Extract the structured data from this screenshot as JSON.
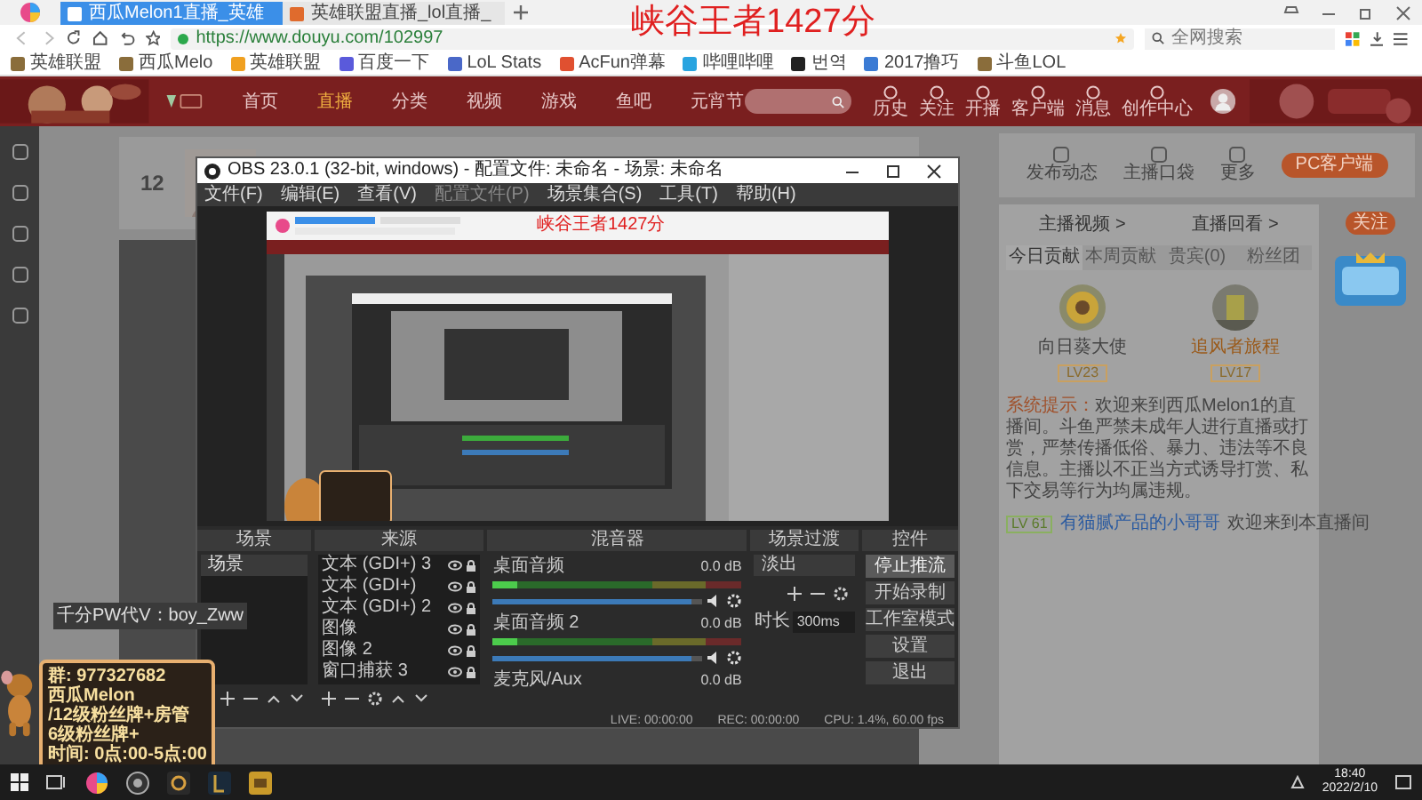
{
  "browser": {
    "tabs": [
      {
        "label": "西瓜Melon1直播_英雄",
        "selected": true
      },
      {
        "label": "英雄联盟直播_lol直播_",
        "selected": false
      }
    ],
    "address": "https://www.douyu.com/102997",
    "search_placeholder": "全网搜索",
    "bookmarks": [
      "英雄联盟",
      "西瓜Melo",
      "英雄联盟",
      "百度一下",
      "LoL Stats",
      "AcFun弹幕",
      "哔哩哔哩",
      "번역",
      "2017撸巧",
      "斗鱼LOL"
    ]
  },
  "overlay_title": "峡谷王者1427分",
  "site": {
    "nav": [
      {
        "label": "首页",
        "selected": false
      },
      {
        "label": "直播",
        "selected": true
      },
      {
        "label": "分类",
        "selected": false
      },
      {
        "label": "视频",
        "selected": false
      },
      {
        "label": "游戏",
        "selected": false
      },
      {
        "label": "鱼吧",
        "selected": false
      },
      {
        "label": "元宵节",
        "selected": false
      }
    ],
    "actions": [
      "历史",
      "关注",
      "开播",
      "客户端",
      "消息",
      "创作中心"
    ],
    "count": "12"
  },
  "chat_panel": {
    "tools": [
      "发布动态",
      "主播口袋",
      "更多"
    ],
    "client_button": "PC客户端",
    "links": [
      "主播视频 >",
      "直播回看 >"
    ],
    "follow_button": "关注",
    "tabs": [
      {
        "label": "今日贡献",
        "selected": true
      },
      {
        "label": "本周贡献",
        "selected": false
      },
      {
        "label": "贵宾(0)",
        "selected": false
      },
      {
        "label": "粉丝团",
        "selected": false
      }
    ],
    "fans": [
      {
        "name": "向日葵大使",
        "badge": "LV23"
      },
      {
        "name": "追风者旅程",
        "badge": "LV17"
      }
    ],
    "system_label": "系统提示：",
    "system_text": "欢迎来到西瓜Melon1的直播间。斗鱼严禁未成年人进行直播或打赏，严禁传播低俗、暴力、违法等不良信息。主播以不正当方式诱导打赏、私下交易等行为均属违规。",
    "chat_line": {
      "badge": "LV 61",
      "user": "有猫腻产品的小哥哥",
      "text": "欢迎来到本直播间"
    }
  },
  "streamer_note": "千分PW代V：boy_Zww",
  "info_card": [
    "群: 977327682",
    "西瓜Melon",
    "/12级粉丝牌+房管",
    "6级粉丝牌+",
    "时间: 0点:00-5点:00"
  ],
  "obs": {
    "title": "OBS 23.0.1 (32-bit, windows) - 配置文件: 未命名 - 场景: 未命名",
    "menu": [
      "文件(F)",
      "编辑(E)",
      "查看(V)",
      "配置文件(P)",
      "场景集合(S)",
      "工具(T)",
      "帮助(H)"
    ],
    "capture_title": "峡谷王者1427分",
    "docks": [
      "场景",
      "来源",
      "混音器",
      "场景过渡",
      "控件"
    ],
    "scenes": [
      {
        "label": "场景",
        "selected": true
      }
    ],
    "sources": [
      "文本 (GDI+) 3",
      "文本 (GDI+)",
      "文本 (GDI+) 2",
      "图像",
      "图像 2",
      "窗口捕获 3"
    ],
    "mixer": [
      {
        "name": "桌面音频",
        "reading": "0.0 dB",
        "level": 0.95
      },
      {
        "name": "桌面音频 2",
        "reading": "0.0 dB",
        "level": 0.95
      },
      {
        "name": "麦克风/Aux",
        "reading": "0.0 dB"
      }
    ],
    "transition": {
      "value": "淡出",
      "duration_label": "时长",
      "duration": "300ms"
    },
    "controls": [
      "停止推流",
      "开始录制",
      "工作室模式",
      "设置",
      "退出"
    ],
    "status": [
      "LIVE: 00:00:00",
      "REC: 00:00:00",
      "CPU: 1.4%, 60.00 fps"
    ]
  },
  "taskbar": {
    "time": "18:40",
    "date": "2022/2/10"
  }
}
